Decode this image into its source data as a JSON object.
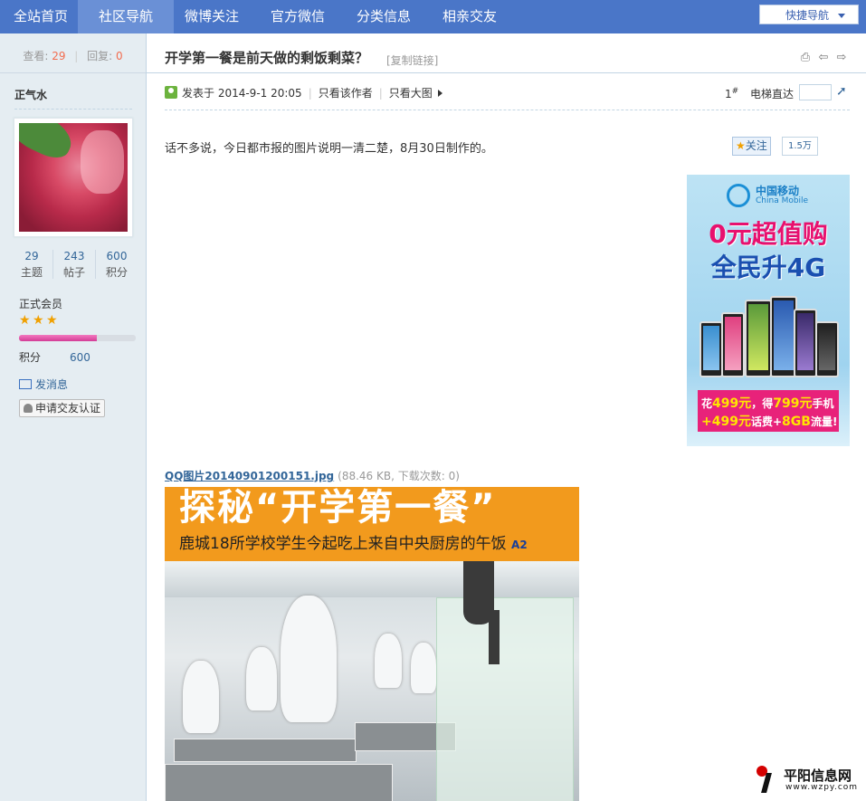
{
  "topnav": {
    "items": [
      "全站首页",
      "社区导航",
      "微博关注",
      "官方微信",
      "分类信息",
      "相亲交友"
    ],
    "quick_nav": "快捷导航"
  },
  "sidebar": {
    "views_label": "查看:",
    "views": "29",
    "replies_label": "回复:",
    "replies": "0",
    "username": "正气水",
    "stats": [
      {
        "value": "29",
        "label": "主题"
      },
      {
        "value": "243",
        "label": "帖子"
      },
      {
        "value": "600",
        "label": "积分"
      }
    ],
    "group": "正式会员",
    "stars": 3,
    "progress": 0.67,
    "score_label": "积分",
    "score_value": "600",
    "send_msg": "发消息",
    "apply_friend": "申请交友认证"
  },
  "post": {
    "title": "开学第一餐是前天做的剩饭剩菜？",
    "copy_link": "[复制链接]",
    "posted_at": "发表于 2014-9-1 20:05",
    "only_author": "只看该作者",
    "only_big_image": "只看大图",
    "floor": "1",
    "floor_sup": "#",
    "elevator": "电梯直达",
    "body": "话不多说，今日都市报的图片说明一清二楚，8月30日制作的。",
    "follow": "关注",
    "follow_count": "1.5万",
    "attachment_name": "QQ图片20140901200151.jpg",
    "attachment_meta": "(88.46 KB, 下载次数: 0)"
  },
  "ad": {
    "brand_cn": "中国移动",
    "brand_en": "China Mobile",
    "headline1": "0元超值购",
    "headline2": "全民升4G",
    "promo_line1_a": "花",
    "promo_line1_b": "499元",
    "promo_line1_c": "，得",
    "promo_line1_d": "799元",
    "promo_line1_e": "手机",
    "promo_line2_a": "+499元",
    "promo_line2_b": "话费+",
    "promo_line2_c": "8GB",
    "promo_line2_d": "流量!"
  },
  "photo": {
    "headline": "探秘“开学第一餐”",
    "subtitle": "鹿城18所学校学生今起吃上来自中央厨房的午饭",
    "tag": "A2"
  },
  "watermark": {
    "name": "平阳信息网",
    "url": "www.wzpy.com"
  },
  "colors": {
    "nav_bg": "#4a76c8",
    "sidebar_bg": "#e5edf2",
    "link": "#336699",
    "accent_orange": "#f26c4f"
  }
}
